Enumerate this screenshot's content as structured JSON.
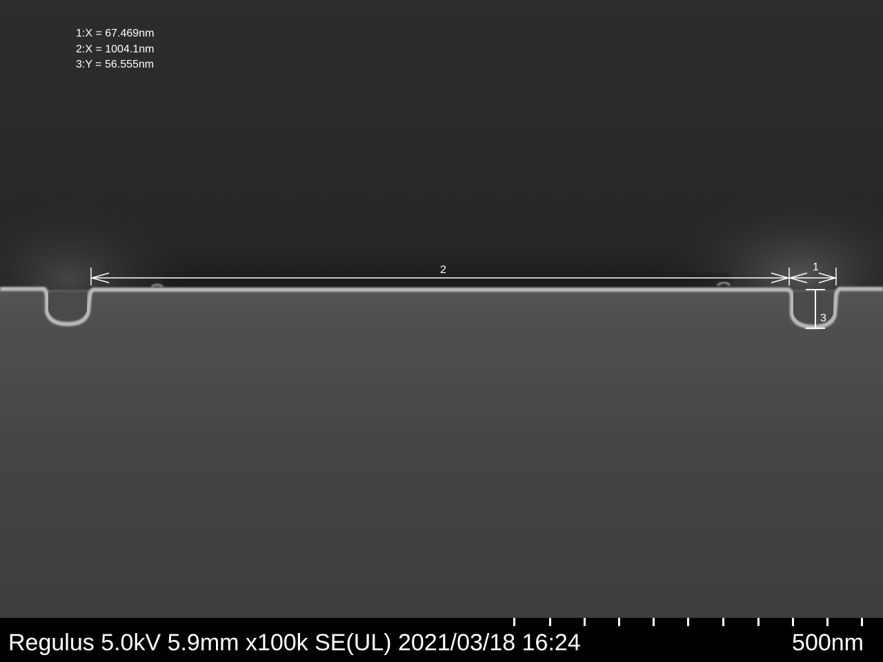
{
  "measurements": [
    "1:X = 67.469nm",
    "2:X = 1004.1nm",
    "3:Y = 56.555nm"
  ],
  "markers": {
    "m1": "1",
    "m2": "2",
    "m3": "3"
  },
  "info_bar": {
    "text": "Regulus 5.0kV 5.9mm x100k SE(UL) 2021/03/18 16:24",
    "scale": "500nm"
  },
  "colors": {
    "annotation": "#ffffff",
    "info_bar_bg": "#000000"
  }
}
